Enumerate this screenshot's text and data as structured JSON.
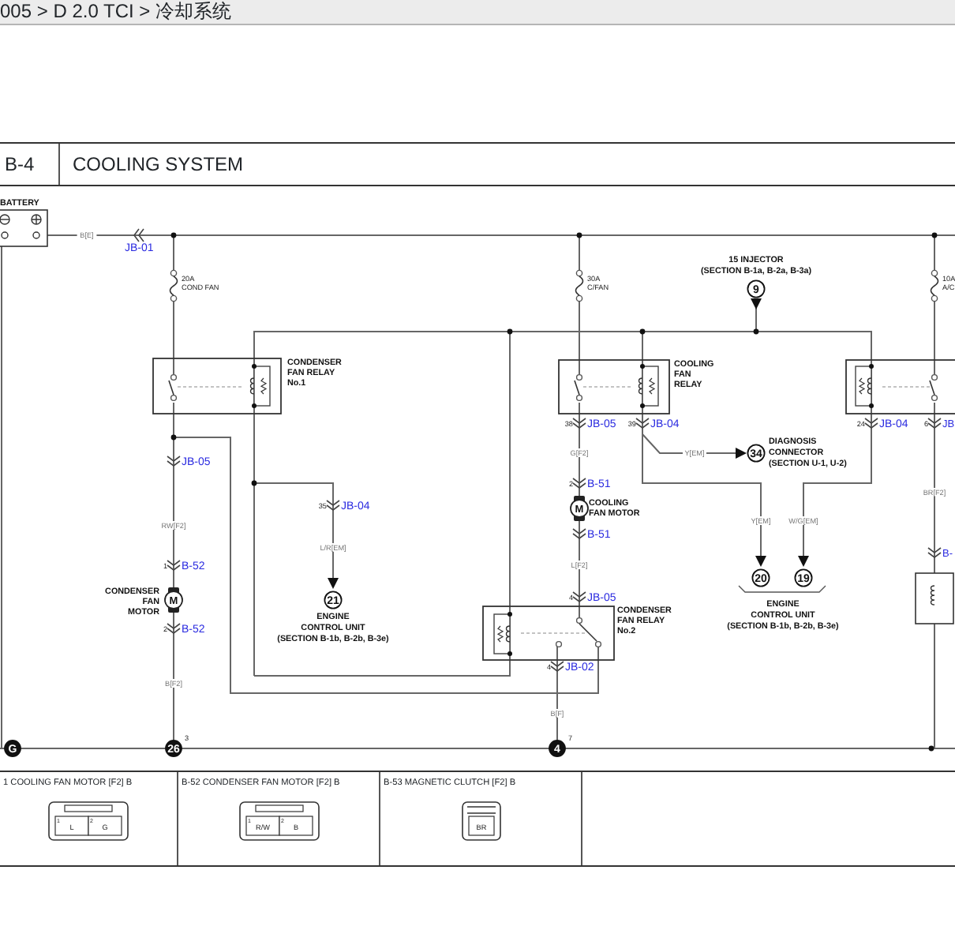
{
  "breadcrumb": "005 > D 2.0 TCI > 冷却系统",
  "diagram": {
    "code": "B-4",
    "title": "COOLING SYSTEM",
    "battery": {
      "label": "BATTERY"
    },
    "fuses": [
      {
        "amps": "20A",
        "name": "COND FAN"
      },
      {
        "amps": "30A",
        "name": "C/FAN"
      },
      {
        "amps": "10A",
        "name": "A/C"
      }
    ],
    "relays": [
      {
        "caption": [
          "CONDENSER",
          "FAN RELAY",
          "No.1"
        ]
      },
      {
        "caption": [
          "COOLING",
          "FAN",
          "RELAY"
        ]
      },
      {
        "caption": [
          "CONDENSER",
          "FAN RELAY",
          "No.2"
        ]
      }
    ],
    "motors": [
      {
        "symbol": "M",
        "caption": [
          "CONDENSER",
          "FAN",
          "MOTOR"
        ]
      },
      {
        "symbol": "M",
        "caption": [
          "COOLING",
          "FAN MOTOR"
        ]
      }
    ],
    "connectors": [
      {
        "ref": "JB-01"
      },
      {
        "ref": "JB-05"
      },
      {
        "ref": "JB-04",
        "pin": "35"
      },
      {
        "ref": "JB-05",
        "pin": "38"
      },
      {
        "ref": "JB-04",
        "pin": "39"
      },
      {
        "ref": "JB-04",
        "pin": "24"
      },
      {
        "ref": "JB",
        "pin": "6"
      },
      {
        "ref": "B-51",
        "pin": "2"
      },
      {
        "ref": "B-51"
      },
      {
        "ref": "JB-05",
        "pin": "4"
      },
      {
        "ref": "JB-02",
        "pin": "4"
      },
      {
        "ref": "B-52",
        "pin": "1"
      },
      {
        "ref": "B-52",
        "pin": "2"
      },
      {
        "ref": "B-"
      }
    ],
    "wire_colors": [
      "B[E]",
      "RW[F2]",
      "B[F2]",
      "L/R[EM]",
      "G[F2]",
      "L[F2]",
      "B[F]",
      "Y[EM]",
      "Y[EM]",
      "W/G[EM]",
      "BR[F2]"
    ],
    "references": [
      {
        "number": "9",
        "caption": [
          "15 INJECTOR",
          "(SECTION B-1a, B-2a, B-3a)"
        ]
      },
      {
        "number": "34",
        "caption": [
          "DIAGNOSIS",
          "CONNECTOR",
          "(SECTION U-1, U-2)"
        ]
      },
      {
        "number": "21",
        "caption": [
          "ENGINE",
          "CONTROL UNIT",
          "(SECTION B-1b, B-2b, B-3e)"
        ]
      }
    ],
    "ecu_pair": {
      "references": [
        {
          "number": "20"
        },
        {
          "number": "19"
        }
      ],
      "caption": [
        "ENGINE",
        "CONTROL UNIT",
        "(SECTION B-1b, B-2b, B-3e)"
      ]
    },
    "grounds": [
      {
        "number": "G"
      },
      {
        "number": "26",
        "pin": "3"
      },
      {
        "number": "4",
        "pin": "7"
      }
    ]
  },
  "connector_views": [
    {
      "title": "1 COOLING FAN MOTOR [F2] B",
      "pins": [
        {
          "number": "1",
          "wire": "L"
        },
        {
          "number": "2",
          "wire": "G"
        }
      ]
    },
    {
      "title": "B-52 CONDENSER FAN MOTOR [F2] B",
      "pins": [
        {
          "number": "1",
          "wire": "R/W"
        },
        {
          "number": "2",
          "wire": "B"
        }
      ]
    },
    {
      "title": "B-53 MAGNETIC CLUTCH [F2] B",
      "pins": [
        {
          "wire": "BR"
        }
      ]
    }
  ]
}
